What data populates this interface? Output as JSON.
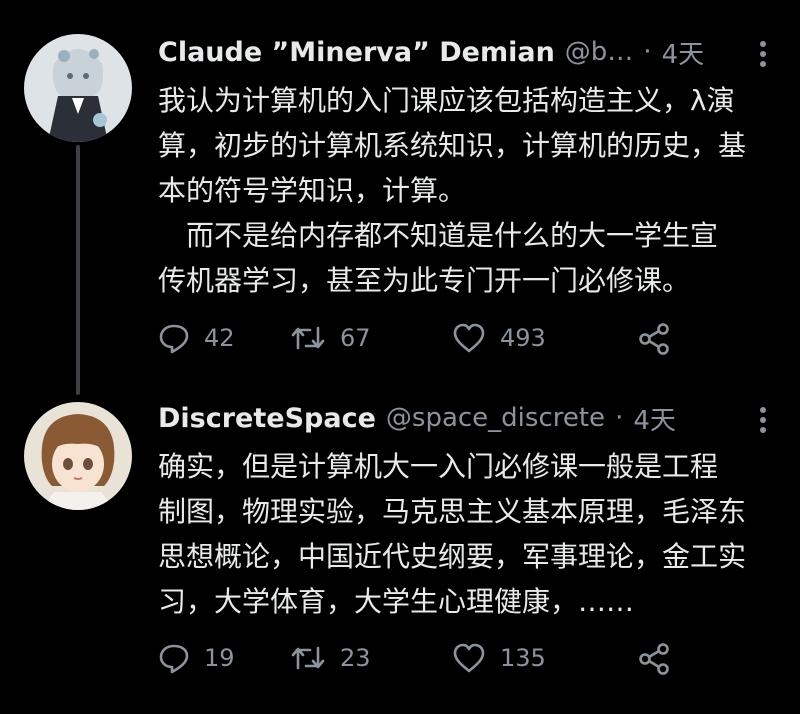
{
  "tweets": [
    {
      "name": "Claude ”Minerva” Demian",
      "handle": "@b…",
      "dot": "·",
      "time": "4天",
      "lines": [
        "我认为计算机的入门课应该包括构造主义，λ演",
        "算，初步的计算机系统知识，计算机的历史，基",
        "本的符号学知识，计算。",
        "　而不是给内存都不知道是什么的大一学生宣",
        "传机器学习，甚至为此专门开一门必修课。"
      ],
      "replies": "42",
      "retweets": "67",
      "likes": "493"
    },
    {
      "name": "DiscreteSpace",
      "handle": "@space_discrete",
      "dot": "·",
      "time": "4天",
      "lines": [
        "确实，但是计算机大一入门必修课一般是工程",
        "制图，物理实验，马克思主义基本原理，毛泽东",
        "思想概论，中国近代史纲要，军事理论，金工实",
        "习，大学体育，大学生心理健康，……"
      ],
      "replies": "19",
      "retweets": "23",
      "likes": "135"
    }
  ],
  "icons": {
    "reply": "reply-icon",
    "retweet": "retweet-icon",
    "like": "heart-icon",
    "share": "share-icon",
    "more": "more-icon"
  },
  "colors": {
    "background": "#000000",
    "text": "#e7e9ea",
    "muted": "#8b949c",
    "thread_line": "#3d4145"
  }
}
